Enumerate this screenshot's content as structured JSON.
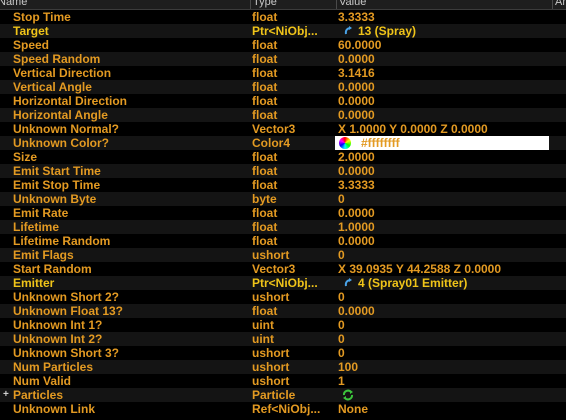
{
  "header": {
    "col_name": "Name",
    "col_type": "Type",
    "col_value": "Value",
    "col_arg": "Arg"
  },
  "rows": [
    {
      "name": "Stop Time",
      "type": "float",
      "value": "3.3333"
    },
    {
      "name": "Target",
      "type": "Ptr<NiObj...",
      "value": "13 (Spray)",
      "icon": "link-icon"
    },
    {
      "name": "Speed",
      "type": "float",
      "value": "60.0000"
    },
    {
      "name": "Speed Random",
      "type": "float",
      "value": "0.0000"
    },
    {
      "name": "Vertical Direction",
      "type": "float",
      "value": "3.1416"
    },
    {
      "name": "Vertical Angle",
      "type": "float",
      "value": "0.0000"
    },
    {
      "name": "Horizontal Direction",
      "type": "float",
      "value": "0.0000"
    },
    {
      "name": "Horizontal Angle",
      "type": "float",
      "value": "0.0000"
    },
    {
      "name": "Unknown Normal?",
      "type": "Vector3",
      "value": "X 1.0000 Y 0.0000 Z 0.0000"
    },
    {
      "name": "Unknown Color?",
      "type": "Color4",
      "value": "#ffffffff",
      "icon": "color-wheel-icon"
    },
    {
      "name": "Size",
      "type": "float",
      "value": "2.0000"
    },
    {
      "name": "Emit Start Time",
      "type": "float",
      "value": "0.0000"
    },
    {
      "name": "Emit Stop Time",
      "type": "float",
      "value": "3.3333"
    },
    {
      "name": "Unknown Byte",
      "type": "byte",
      "value": "0"
    },
    {
      "name": "Emit Rate",
      "type": "float",
      "value": "0.0000"
    },
    {
      "name": "Lifetime",
      "type": "float",
      "value": "1.0000"
    },
    {
      "name": "Lifetime Random",
      "type": "float",
      "value": "0.0000"
    },
    {
      "name": "Emit Flags",
      "type": "ushort",
      "value": "0"
    },
    {
      "name": "Start Random",
      "type": "Vector3",
      "value": "X 39.0935 Y 44.2588 Z 0.0000"
    },
    {
      "name": "Emitter",
      "type": "Ptr<NiObj...",
      "value": "4 (Spray01 Emitter)",
      "icon": "link-icon"
    },
    {
      "name": "Unknown Short 2?",
      "type": "ushort",
      "value": "0"
    },
    {
      "name": "Unknown Float 13?",
      "type": "float",
      "value": "0.0000"
    },
    {
      "name": "Unknown Int 1?",
      "type": "uint",
      "value": "0"
    },
    {
      "name": "Unknown Int 2?",
      "type": "uint",
      "value": "0"
    },
    {
      "name": "Unknown Short 3?",
      "type": "ushort",
      "value": "0"
    },
    {
      "name": "Num Particles",
      "type": "ushort",
      "value": "100"
    },
    {
      "name": "Num Valid",
      "type": "ushort",
      "value": "1"
    },
    {
      "name": "Particles",
      "type": "Particle",
      "value": "",
      "icon": "particles-icon",
      "expander": "+"
    },
    {
      "name": "Unknown Link",
      "type": "Ref<NiObj...",
      "value": "None"
    }
  ],
  "colors": {
    "text_orange": "#e39a22",
    "text_bright": "#f0c419",
    "background": "#000000"
  }
}
